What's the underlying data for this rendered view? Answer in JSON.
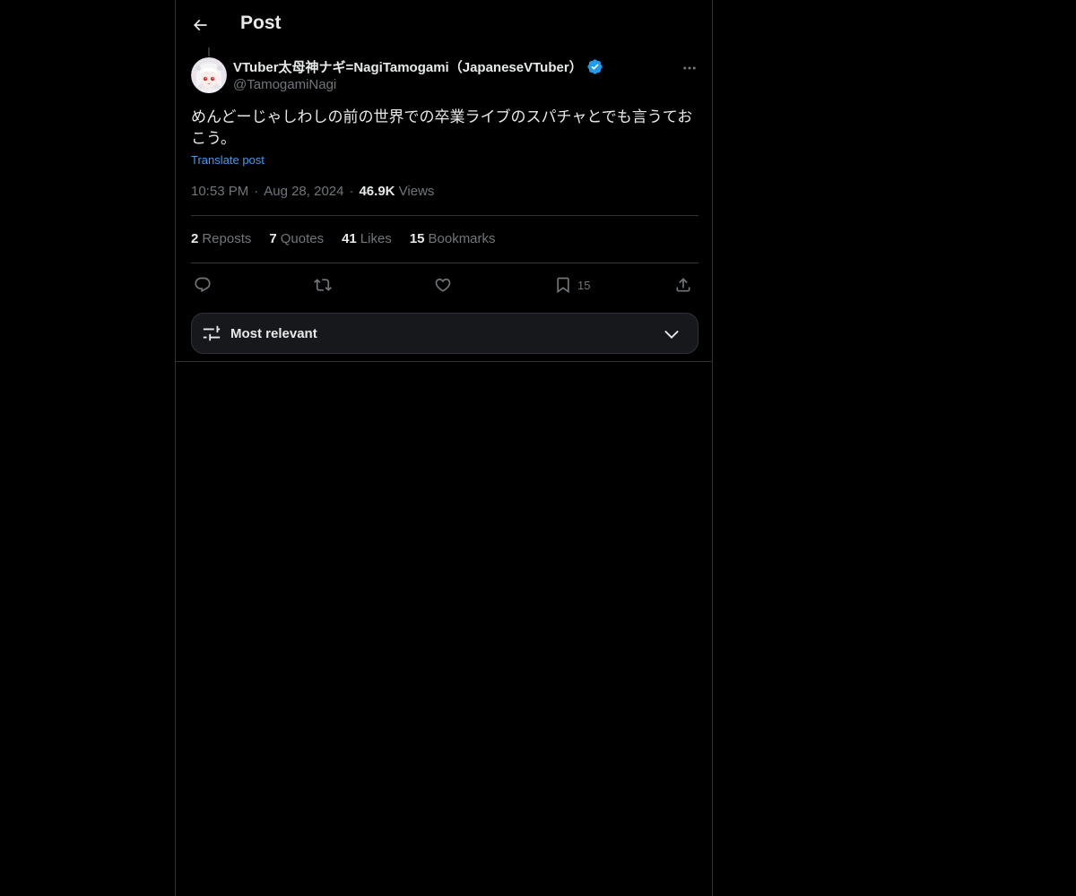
{
  "header": {
    "title": "Post",
    "back_icon": "arrow-left-icon"
  },
  "post": {
    "author_name": "VTuber太母神ナギ=NagiTamogami（JapaneseVTuber）",
    "author_handle": "@TamogamiNagi",
    "verified_icon": "verified-badge-icon",
    "text": "めんどーじゃしわしの前の世界での卒業ライブのスパチャとでも言うておこう。",
    "translate_label": "Translate post",
    "time": "10:53 PM",
    "date": "Aug 28, 2024",
    "views_count": "46.9K",
    "views_label": "Views",
    "separator": "·"
  },
  "stats": {
    "reposts_count": "2",
    "reposts_label": "Reposts",
    "quotes_count": "7",
    "quotes_label": "Quotes",
    "likes_count": "41",
    "likes_label": "Likes",
    "bookmarks_count": "15",
    "bookmarks_label": "Bookmarks"
  },
  "actions": {
    "reply_icon": "reply-icon",
    "repost_icon": "repost-icon",
    "like_icon": "heart-icon",
    "bookmark_icon": "bookmark-icon",
    "bookmark_count": "15",
    "share_icon": "share-icon"
  },
  "sort": {
    "label": "Most relevant",
    "icon": "sliders-icon",
    "chevron": "chevron-down-icon"
  },
  "colors": {
    "background": "#000000",
    "text_primary": "#e7e9ea",
    "text_secondary": "#71767b",
    "link": "#4a99e9",
    "verified": "#1d9bf0",
    "border": "#2f3336"
  }
}
